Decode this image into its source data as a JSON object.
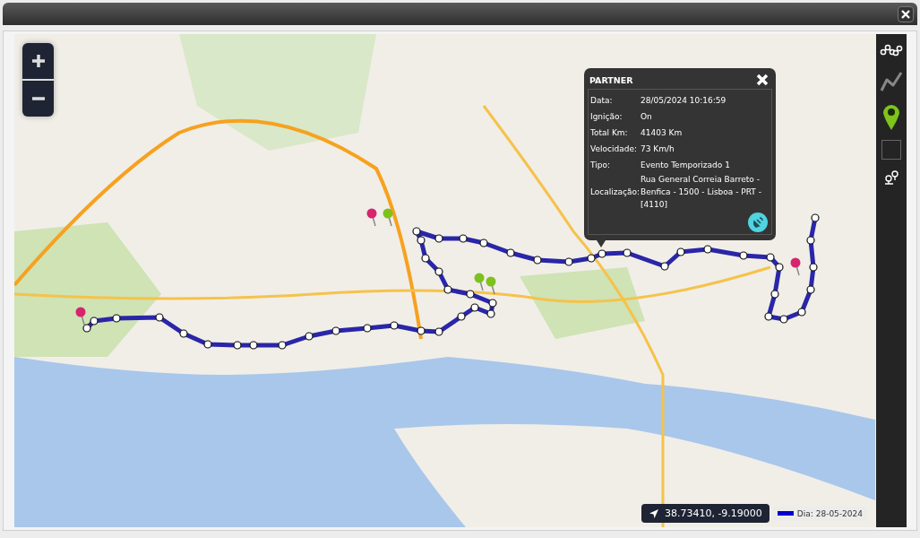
{
  "popup": {
    "title": "PARTNER",
    "fields": [
      {
        "label": "Data:",
        "value": "28/05/2024 10:16:59"
      },
      {
        "label": "Ignição:",
        "value": "On"
      },
      {
        "label": "Total Km:",
        "value": "41403 Km"
      },
      {
        "label": "Velocidade:",
        "value": "73 Km/h"
      },
      {
        "label": "Tipo:",
        "value": "Evento Temporizado 1"
      },
      {
        "label": "Localização:",
        "value": "Rua General Correia Barreto - Benfica - 1500 - Lisboa - PRT - [4110]"
      }
    ]
  },
  "toolbar": [
    {
      "kind": "route"
    },
    {
      "kind": "track"
    },
    {
      "kind": "marker"
    },
    {
      "kind": "checkbox",
      "checked": false
    },
    {
      "kind": "pins"
    }
  ],
  "coordinates": "38.73410, -9.19000",
  "legend": {
    "label": "Dia: 28-05-2024",
    "color": "#0000cc"
  }
}
